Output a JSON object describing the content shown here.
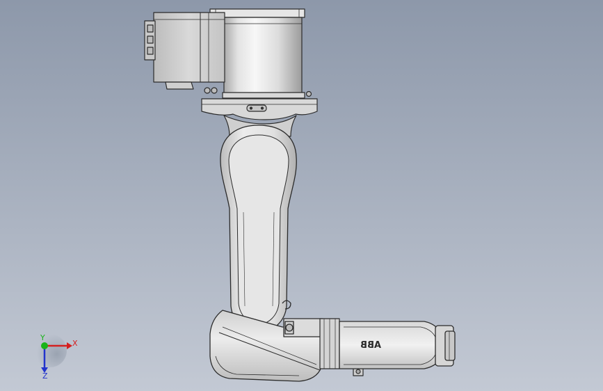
{
  "viewport": {
    "background_top": "#8d98aa",
    "background_bottom": "#c3c9d4"
  },
  "model": {
    "logo_text": "ABB",
    "body_color": "#e1e1e1",
    "edge_color": "#2b2b2b"
  },
  "triad": {
    "x_label": "X",
    "y_label": "Y",
    "z_label": "Z",
    "x_color": "#d42020",
    "y_color": "#19b319",
    "z_color": "#2233cc"
  }
}
